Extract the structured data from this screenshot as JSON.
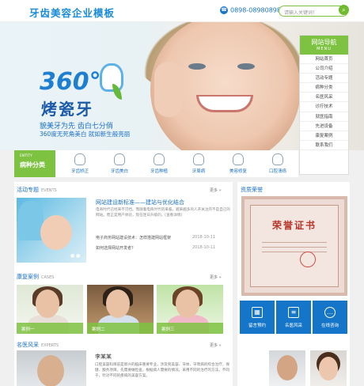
{
  "header": {
    "logo": "牙齿美容企业模板",
    "phone": "0898-08980898",
    "phone_icon": "phone-icon",
    "search_placeholder": "请输入关键词！",
    "search_icon": "search-icon"
  },
  "hero": {
    "big_number": "360°",
    "big_text": "烤瓷牙",
    "line1": "貌美牙为先  齿白七分俏",
    "line2": "360度无死角美白  就如新生般亮丽"
  },
  "nav": {
    "title": "网站导航",
    "subtitle": "MENU",
    "items": [
      "网站首页",
      "公司介绍",
      "活动专题",
      "病种分类",
      "名医风采",
      "诊疗技术",
      "就医指南",
      "先进设备",
      "康复案例",
      "联系我们"
    ]
  },
  "categories": {
    "en": "ENTITY",
    "title": "病种分类",
    "items": [
      "牙齿矫正",
      "牙齿美白",
      "牙齿种植",
      "牙周病",
      "美容修复",
      "口腔溃疡"
    ]
  },
  "activity": {
    "title": "活动专题",
    "en": "EVENTS",
    "more": "更多 »",
    "headline": "网站建设新标准——建站与优化结合",
    "summary": "电商时代已经来不可挡。而随着电商时代的来临，越来越多的人开关注的不是自己的网站。而正是用户体验，现在连日升级的。[查看详情]",
    "news": [
      {
        "title": "电子商务网站建设技术：怎样搭建网站框架",
        "date": "2018-10-11"
      },
      {
        "title": "如何选择网站开发者？",
        "date": "2018-10-11"
      }
    ]
  },
  "cases": {
    "title": "康复案例",
    "en": "CASES",
    "more": "更多 »",
    "items": [
      "案例一",
      "案例二",
      "案例三"
    ]
  },
  "doctors": {
    "title": "名医风采",
    "en": "EXPERTS",
    "more": "更多 »",
    "name": "李某某",
    "desc": "口腔美容科目前是新兴的临床重要专业，涉及到美容、牙体、牙周病的综合治疗，保健、服务项目。先需要做检查，根据病人需要的情况，采用不同的治疗的方法，不同于，针对不同的疾病的美容方案。"
  },
  "honors": {
    "title": "资质荣誉",
    "cert_title": "荣誉证书"
  },
  "quick": [
    {
      "label": "留言预约",
      "icon": "calendar-icon"
    },
    {
      "label": "名医风采",
      "icon": "document-icon"
    },
    {
      "label": "在线咨询",
      "icon": "chat-icon"
    }
  ]
}
